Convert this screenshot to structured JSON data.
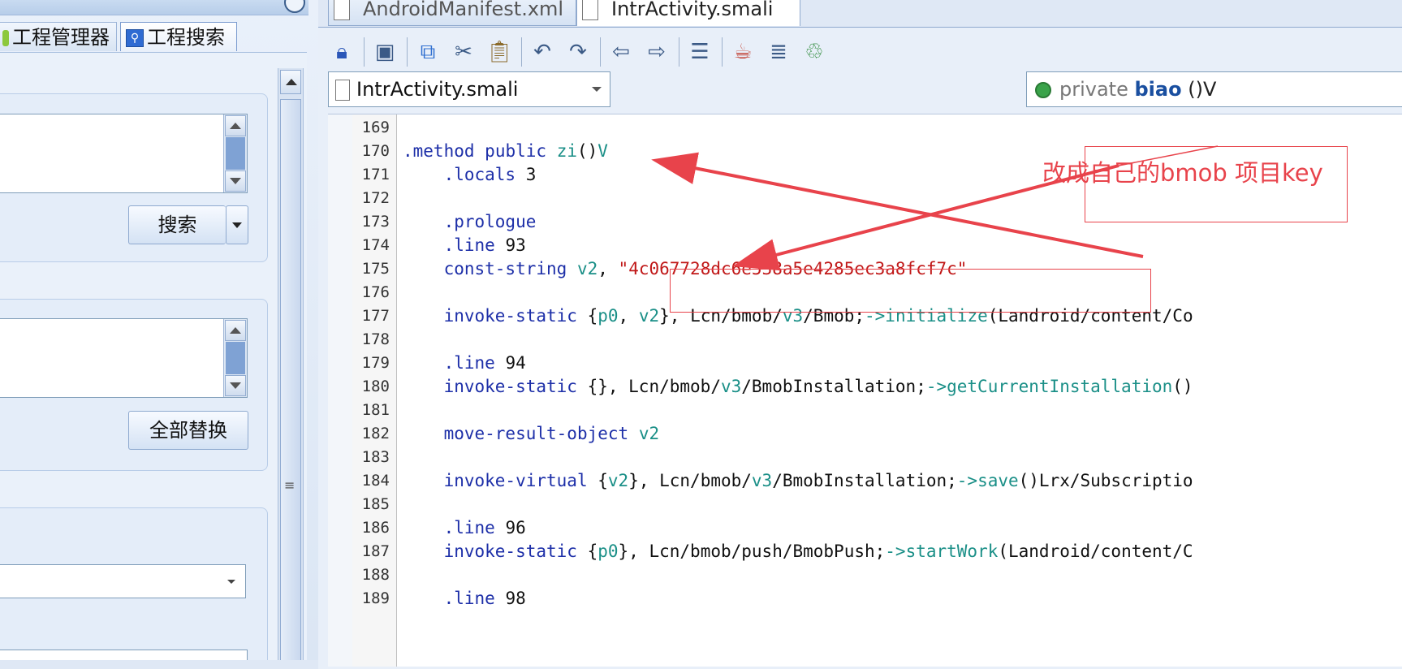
{
  "left_panel": {
    "tabs": [
      {
        "label": "工程管理器",
        "icon": "project-manager-icon"
      },
      {
        "label": "工程搜索",
        "icon": "search-icon"
      }
    ],
    "search_button": "搜索",
    "replace_all_button": "全部替换"
  },
  "editor": {
    "tabs": [
      {
        "label": "AndroidManifest.xml",
        "active": false
      },
      {
        "label": "IntrActivity.smali",
        "active": true
      }
    ],
    "toolbar_icons": [
      "lock-icon",
      "save-icon",
      "copy-icon",
      "cut-icon",
      "paste-icon",
      "undo-icon",
      "redo-icon",
      "back-icon",
      "forward-icon",
      "format-icon",
      "java-icon",
      "list-icon",
      "refresh-icon"
    ],
    "file_selector": "IntrActivity.smali",
    "method_selector": {
      "modifier": "private",
      "name": "biao",
      "signature": "()V"
    },
    "code_lines": [
      {
        "n": "169",
        "t": ""
      },
      {
        "n": "170",
        "t": ".method public zi()V"
      },
      {
        "n": "171",
        "t": "    .locals 3"
      },
      {
        "n": "172",
        "t": ""
      },
      {
        "n": "173",
        "t": "    .prologue"
      },
      {
        "n": "174",
        "t": "    .line 93"
      },
      {
        "n": "175",
        "t": "    const-string v2, \"4c067728dc6e538a5e4285ec3a8fcf7c\""
      },
      {
        "n": "176",
        "t": ""
      },
      {
        "n": "177",
        "t": "    invoke-static {p0, v2}, Lcn/bmob/v3/Bmob;->initialize(Landroid/content/Co"
      },
      {
        "n": "178",
        "t": ""
      },
      {
        "n": "179",
        "t": "    .line 94"
      },
      {
        "n": "180",
        "t": "    invoke-static {}, Lcn/bmob/v3/BmobInstallation;->getCurrentInstallation()"
      },
      {
        "n": "181",
        "t": ""
      },
      {
        "n": "182",
        "t": "    move-result-object v2"
      },
      {
        "n": "183",
        "t": ""
      },
      {
        "n": "184",
        "t": "    invoke-virtual {v2}, Lcn/bmob/v3/BmobInstallation;->save()Lrx/Subscriptio"
      },
      {
        "n": "185",
        "t": ""
      },
      {
        "n": "186",
        "t": "    .line 96"
      },
      {
        "n": "187",
        "t": "    invoke-static {p0}, Lcn/bmob/push/BmobPush;->startWork(Landroid/content/C"
      },
      {
        "n": "188",
        "t": ""
      },
      {
        "n": "189",
        "t": "    .line 98"
      }
    ]
  },
  "annotation": {
    "note": "改成自己的bmob 项目key",
    "color": "#e8434b"
  },
  "colors": {
    "directive": "#1d2fa8",
    "register": "#1a8f87",
    "number": "#c0398e",
    "string": "#c01818"
  }
}
